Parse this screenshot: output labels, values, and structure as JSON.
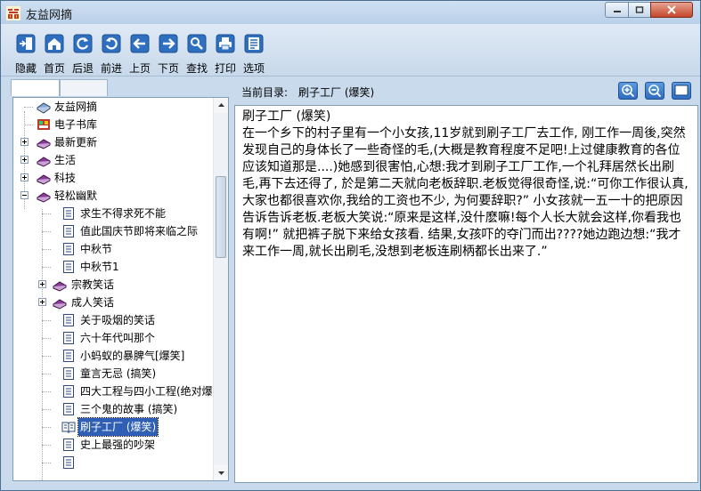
{
  "window": {
    "title": "友益网摘"
  },
  "toolbar": {
    "items": [
      {
        "label": "隐藏",
        "icon": "hide-icon"
      },
      {
        "label": "首页",
        "icon": "home-icon"
      },
      {
        "label": "后退",
        "icon": "refresh-back-icon"
      },
      {
        "label": "前进",
        "icon": "refresh-forward-icon"
      },
      {
        "label": "上页",
        "icon": "arrow-left-icon"
      },
      {
        "label": "下页",
        "icon": "arrow-right-icon"
      },
      {
        "label": "查找",
        "icon": "search-icon"
      },
      {
        "label": "打印",
        "icon": "printer-icon"
      },
      {
        "label": "选项",
        "icon": "options-icon"
      }
    ]
  },
  "tree": {
    "nodes": [
      {
        "label": "友益网摘"
      },
      {
        "label": "电子书库"
      },
      {
        "label": "最新更新"
      },
      {
        "label": "生活"
      },
      {
        "label": "科技"
      },
      {
        "label": "轻松幽默"
      },
      {
        "label": "求生不得求死不能"
      },
      {
        "label": "值此国庆节即将来临之际"
      },
      {
        "label": "中秋节"
      },
      {
        "label": "中秋节1"
      },
      {
        "label": "宗教笑话"
      },
      {
        "label": "成人笑话"
      },
      {
        "label": "关于吸烟的笑话"
      },
      {
        "label": "六十年代叫那个"
      },
      {
        "label": "小蚂蚁的暴脾气[爆笑]"
      },
      {
        "label": "童言无忌 (搞笑)"
      },
      {
        "label": "四大工程与四小工程(绝对爆"
      },
      {
        "label": "三个鬼的故事 (搞笑)"
      },
      {
        "label": "刷子工厂 (爆笑)"
      },
      {
        "label": "史上最强的吵架"
      }
    ]
  },
  "directory": {
    "label": "当前目录:",
    "value": "刷子工厂 (爆笑)"
  },
  "article": {
    "title": "刷子工厂 (爆笑)",
    "body": "在一个乡下的村子里有一个小女孩,11岁就到刷子工厂去工作, 刚工作一周後,突然发现自己的身体长了一些奇怪的毛,(大概是教育程度不足吧!上过健康教育的各位应该知道那是....)她感到很害怕,心想:我才到刷子工厂工作,一个礼拜居然长出刷毛,再下去还得了, 於是第二天就向老板辞职.老板觉得很奇怪,说:“可你工作很认真,大家也都很喜欢你,我给的工资也不少, 为何要辞职?” 小女孩就一五一十的把原因告诉告诉老板.老板大笑说:“原来是这样,没什麽嘛!每个人长大就会这样,你看我也有啊!” 就把裤子脱下来给女孩看. 结果,女孩吓的夺门而出????她边跑边想:“我才来工作一周,就长出刷毛,没想到老板连刷柄都长出来了.”"
  }
}
